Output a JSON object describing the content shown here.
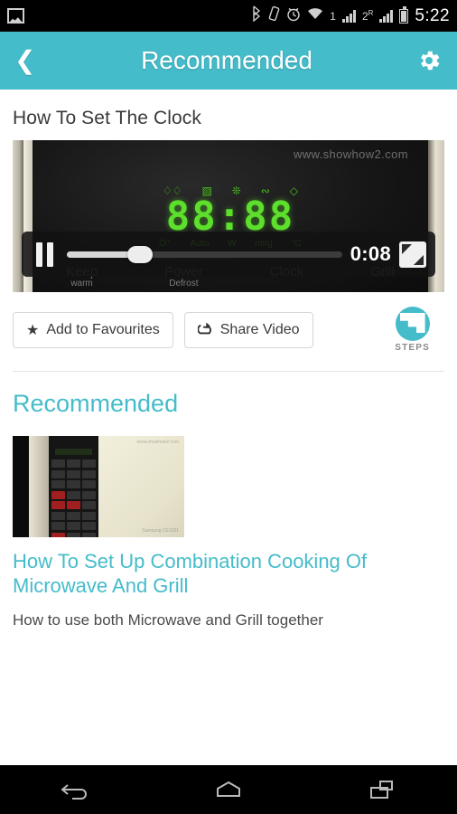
{
  "status_bar": {
    "photo_icon": "photo-icon",
    "bluetooth_icon": "bluetooth-icon",
    "vibrate_icon": "vibrate-icon",
    "alarm_icon": "alarm-clock-icon",
    "wifi_icon": "wifi-icon",
    "sim1_label": "1",
    "sim2_label": "2",
    "sim2_roaming": "R",
    "battery_icon": "battery-icon",
    "time": "5:22"
  },
  "app_bar": {
    "back_icon": "back-chevron-icon",
    "title": "Recommended",
    "settings_icon": "gear-icon",
    "accent_color": "#45bcca"
  },
  "main": {
    "video_title": "How To Set The Clock",
    "player": {
      "watermark": "www.showhow2.com",
      "led_digits": "88:88",
      "led_top_icons": [
        "defrost-drops-icon",
        "grill-icon",
        "fan-icon",
        "heating-element-icon",
        "power-icon"
      ],
      "led_bottom_labels": [
        "Ò⁺",
        "Auto",
        "W",
        "ml/g",
        "°C"
      ],
      "panel_keys": [
        {
          "label": "Keep",
          "sub": "warm"
        },
        {
          "label": "Power",
          "sub": "Defrost"
        },
        {
          "label": "Clock",
          "sub": ""
        },
        {
          "label": "Grill",
          "sub": ""
        }
      ],
      "pause_icon": "pause-icon",
      "seek_position_percent": 25,
      "current_time": "0:08",
      "fullscreen_icon": "fullscreen-icon"
    },
    "actions": {
      "favourite_icon": "star-icon",
      "favourite_label": "Add to Favourites",
      "share_icon": "share-icon",
      "share_label": "Share Video",
      "steps_icon": "steps-stairs-icon",
      "steps_label": "STEPS"
    },
    "section_title": "Recommended",
    "recommended_items": [
      {
        "thumbnail_icon": "microwave-control-panel-thumbnail",
        "thumbnail_watermark": "www.showhow2.com",
        "thumbnail_brand": "Samsung CE1031",
        "title": "How To Set Up Combination Cooking Of Microwave And Grill",
        "description": "How to use both Microwave and Grill together"
      }
    ]
  },
  "nav_bar": {
    "back_icon": "android-back-icon",
    "home_icon": "android-home-icon",
    "recents_icon": "android-recents-icon"
  }
}
